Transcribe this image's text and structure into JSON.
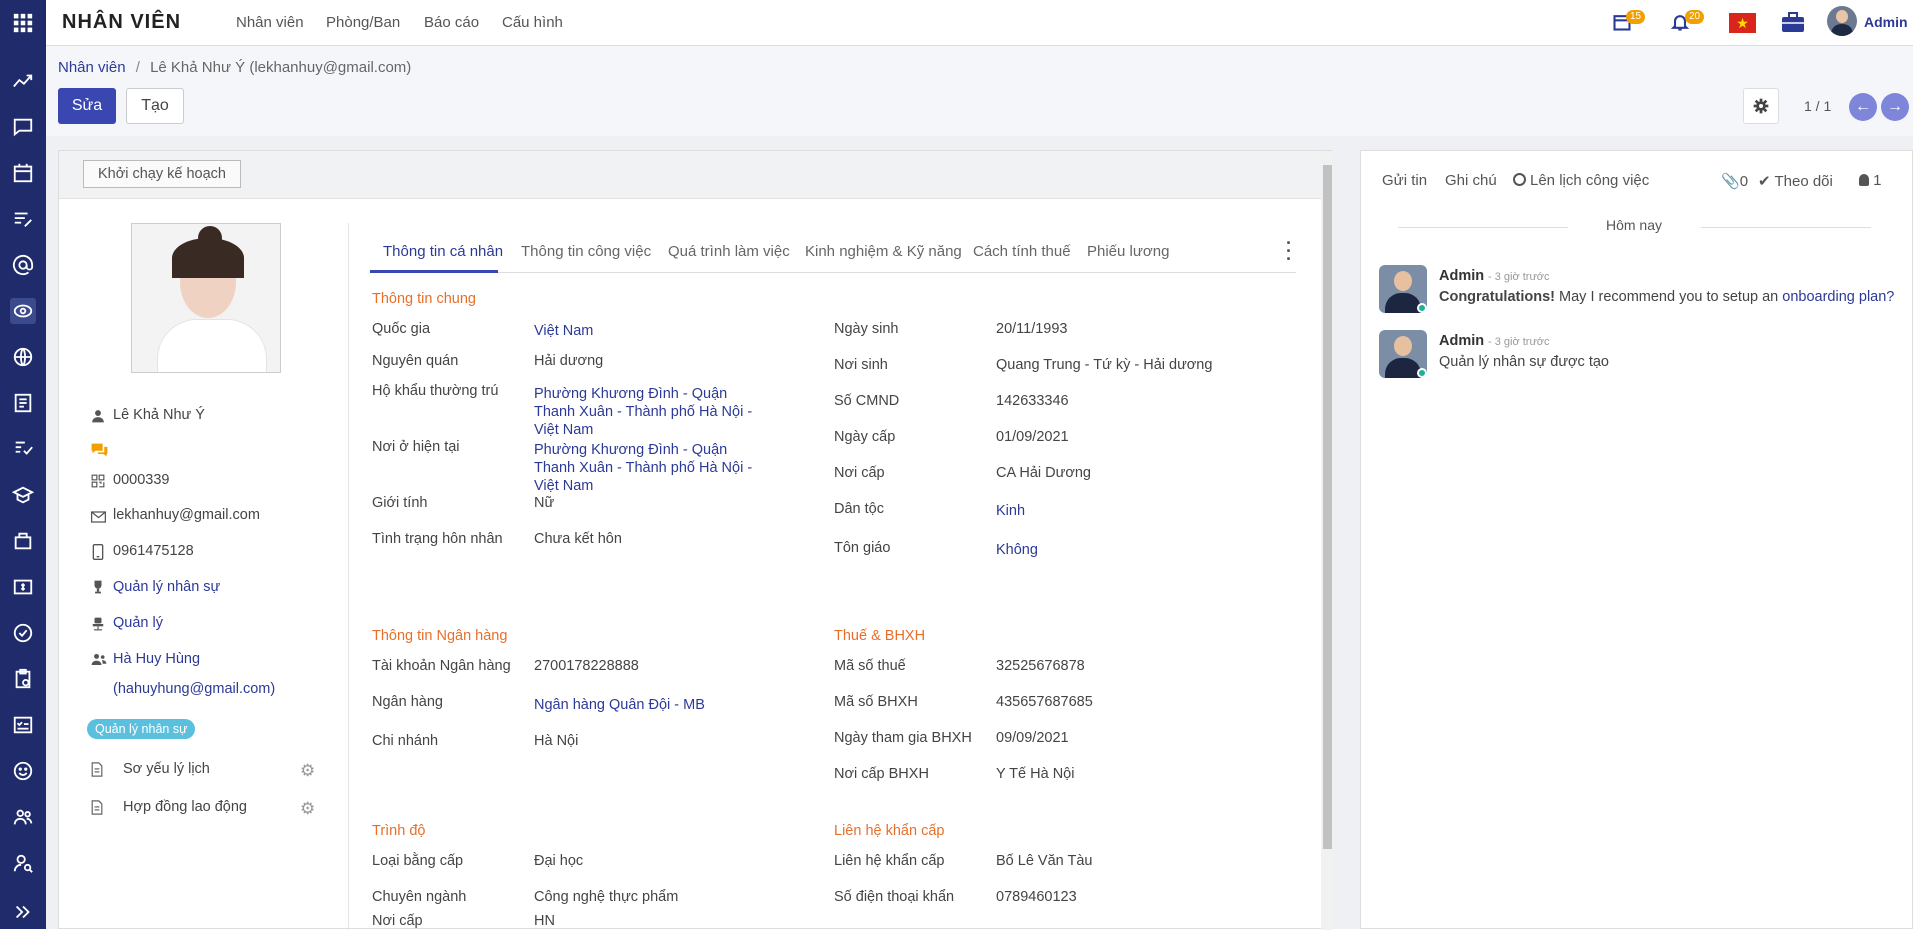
{
  "topbar": {
    "app_title": "NHÂN VIÊN",
    "menu": [
      "Nhân viên",
      "Phòng/Ban",
      "Báo cáo",
      "Cấu hình"
    ],
    "calendar_badge": "15",
    "notif_badge": "20",
    "user_name": "Admin"
  },
  "breadcrumb": {
    "root": "Nhân viên",
    "separator": "/",
    "current": "Lê Khả Như Ý (lekhanhuy@gmail.com)"
  },
  "actions": {
    "edit": "Sửa",
    "create": "Tạo",
    "pager": "1 / 1"
  },
  "form": {
    "launch_plan": "Khởi chạy kế hoạch",
    "profile": {
      "name": "Lê Khả Như Ý",
      "code": "0000339",
      "email": "lekhanhuy@gmail.com",
      "phone": "0961475128",
      "department": "Quản lý nhân sự",
      "job": "Quản lý",
      "manager": "Hà Huy Hùng",
      "manager_email": "(hahuyhung@gmail.com)",
      "tag": "Quản lý nhân sự",
      "docs": [
        "Sơ yếu lý lịch",
        "Hợp đồng lao động"
      ]
    },
    "tabs": [
      "Thông tin cá nhân",
      "Thông tin công việc",
      "Quá trình làm việc",
      "Kinh nghiệm & Kỹ năng",
      "Cách tính thuế",
      "Phiếu lương"
    ],
    "general": {
      "title": "Thông tin chung",
      "left": [
        {
          "label": "Quốc gia",
          "value": "Việt Nam"
        },
        {
          "label": "Nguyên quán",
          "value": "Hải dương"
        },
        {
          "label": "Hộ khẩu thường trú",
          "value": "Phường Khương Đình - Quận Thanh Xuân - Thành phố Hà Nội - Việt Nam"
        },
        {
          "label": "Nơi ở hiện tại",
          "value": "Phường Khương Đình - Quận Thanh Xuân - Thành phố Hà Nội - Việt Nam"
        },
        {
          "label": "Giới tính",
          "value": "Nữ"
        },
        {
          "label": "Tình trạng hôn nhân",
          "value": "Chưa kết hôn"
        }
      ],
      "right": [
        {
          "label": "Ngày sinh",
          "value": "20/11/1993"
        },
        {
          "label": "Nơi sinh",
          "value": "Quang Trung - Tứ kỳ - Hải dương"
        },
        {
          "label": "Số CMND",
          "value": "142633346"
        },
        {
          "label": "Ngày cấp",
          "value": "01/09/2021"
        },
        {
          "label": "Nơi cấp",
          "value": "CA Hải Dương"
        },
        {
          "label": "Dân tộc",
          "value": "Kinh"
        },
        {
          "label": "Tôn giáo",
          "value": "Không"
        }
      ]
    },
    "bank": {
      "title": "Thông tin Ngân hàng",
      "rows": [
        {
          "label": "Tài khoản Ngân hàng",
          "value": "2700178228888"
        },
        {
          "label": "Ngân hàng",
          "value": "Ngân hàng Quân Đội - MB"
        },
        {
          "label": "Chi nhánh",
          "value": "Hà Nội"
        }
      ]
    },
    "tax": {
      "title": "Thuế & BHXH",
      "rows": [
        {
          "label": "Mã số thuế",
          "value": "32525676878"
        },
        {
          "label": "Mã số BHXH",
          "value": "435657687685"
        },
        {
          "label": "Ngày tham gia BHXH",
          "value": "09/09/2021"
        },
        {
          "label": "Nơi cấp BHXH",
          "value": "Y Tế Hà Nội"
        }
      ]
    },
    "education": {
      "title": "Trình độ",
      "rows": [
        {
          "label": "Loại bằng cấp",
          "value": "Đại học"
        },
        {
          "label": "Chuyên ngành",
          "value": "Công nghệ thực phẩm"
        },
        {
          "label": "Nơi cấp",
          "value": "HN"
        }
      ]
    },
    "emergency": {
      "title": "Liên hệ khẩn cấp",
      "rows": [
        {
          "label": "Liên hệ khẩn cấp",
          "value": "Bố Lê Văn Tàu"
        },
        {
          "label": "Số điện thoại khẩn",
          "value": "0789460123"
        }
      ]
    }
  },
  "chatter": {
    "send": "Gửi tin",
    "note": "Ghi chú",
    "schedule": "Lên lịch công việc",
    "attachments": "0",
    "follow": "Theo dõi",
    "followers": "1",
    "today": "Hôm nay",
    "messages": [
      {
        "author": "Admin",
        "time": "- 3 giờ trước",
        "bold": "Congratulations!",
        "text": " May I recommend you to setup an ",
        "link": "onboarding plan?"
      },
      {
        "author": "Admin",
        "time": "- 3 giờ trước",
        "text": "Quản lý nhân sự được tạo"
      }
    ]
  },
  "colors": {
    "sidebar": "#1f2b6b",
    "primary": "#3a47b1",
    "orange": "#e86f2a",
    "link": "#2c3a97"
  }
}
